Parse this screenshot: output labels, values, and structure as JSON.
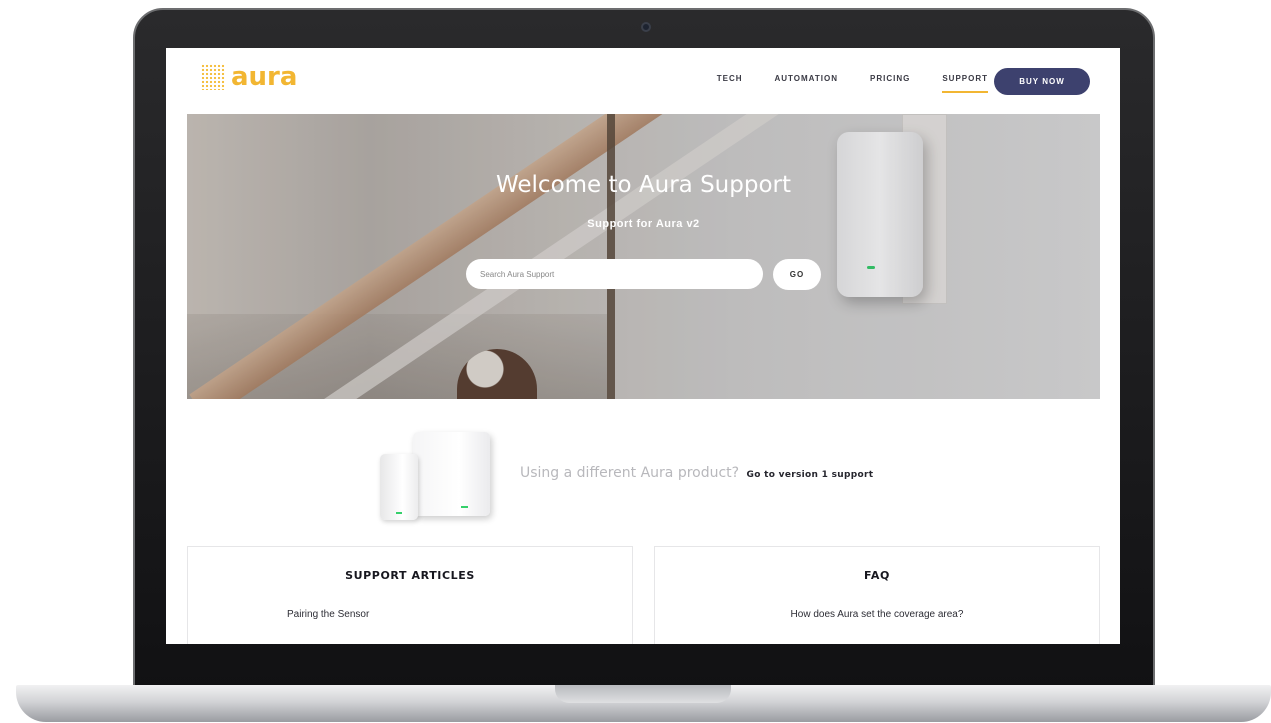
{
  "site": {
    "logo_text": "aura",
    "brand_color": "#f2b632",
    "accent_color": "#3d416e"
  },
  "nav": {
    "links": [
      "TECH",
      "AUTOMATION",
      "PRICING",
      "SUPPORT"
    ],
    "active_link": "SUPPORT",
    "buy_label": "BUY NOW"
  },
  "hero": {
    "title": "Welcome to Aura Support",
    "subtitle": "Support for Aura v2",
    "search_placeholder": "Search Aura Support",
    "go_label": "GO"
  },
  "product_switch": {
    "prompt": "Using a different Aura product?",
    "link": "Go to version 1 support"
  },
  "cards": {
    "articles": {
      "title": "SUPPORT ARTICLES",
      "items": [
        "Pairing the Sensor"
      ]
    },
    "faq": {
      "title": "FAQ",
      "items": [
        "How does Aura set the coverage area?"
      ]
    }
  }
}
